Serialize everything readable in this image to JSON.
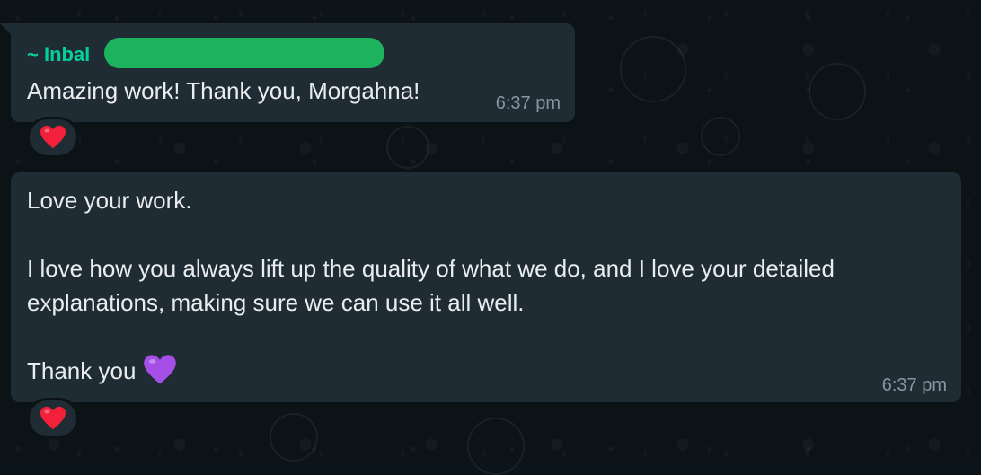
{
  "messages": [
    {
      "sender": "~ Inbal",
      "text": "Amazing work! Thank you, Morgahna!",
      "time": "6:37 pm",
      "reaction": "red-heart"
    },
    {
      "lines": [
        "Love your work.",
        "I love how you always lift up the quality of what we do, and I love your detailed",
        "explanations, making sure we can use it all well.",
        "Thank you"
      ],
      "trailing_emoji": "purple-heart",
      "time": "6:37 pm",
      "reaction": "red-heart"
    }
  ],
  "colors": {
    "bubble": "#202c33",
    "sender": "#06cf9c",
    "redaction": "#1db35e",
    "text": "#e9edef",
    "timestamp": "#8696a0",
    "background": "#0c1317"
  }
}
